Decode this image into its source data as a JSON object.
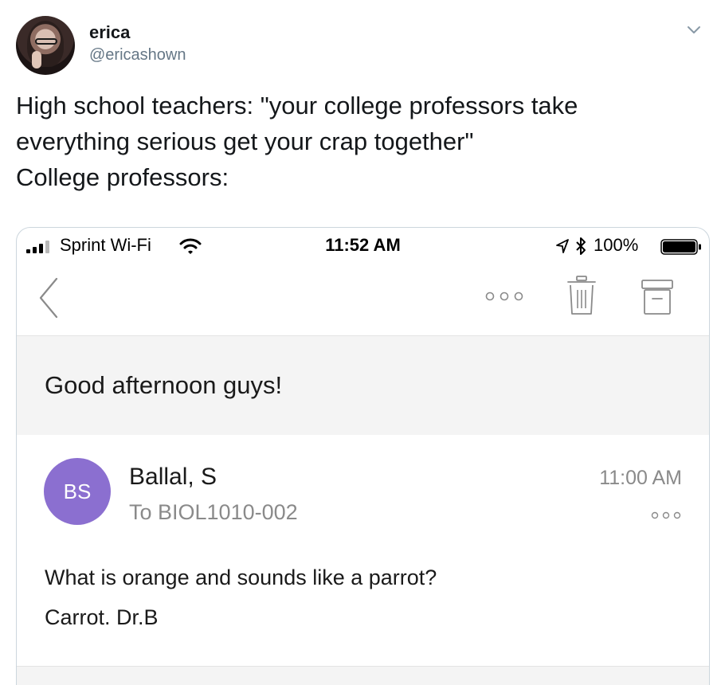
{
  "tweet": {
    "display_name": "erica",
    "handle": "@ericashown",
    "text_lines": [
      "High school teachers: \"your college professors take",
      "everything serious get your crap together\"",
      "College professors:"
    ],
    "icons": {
      "menu": "chevron-down-icon",
      "avatar": "profile-photo"
    }
  },
  "screenshot": {
    "status_bar": {
      "carrier": "Sprint Wi-Fi",
      "time": "11:52 AM",
      "battery_percent": "100%",
      "battery_level": 1.0,
      "icons": [
        "signal-bars-icon",
        "wifi-icon",
        "location-arrow-icon",
        "bluetooth-icon",
        "battery-icon"
      ]
    },
    "nav_bar": {
      "icons": [
        "back-chevron-icon",
        "more-options-icon",
        "trash-icon",
        "archive-icon"
      ]
    },
    "email": {
      "subject": "Good afternoon guys!",
      "sender_initials": "BS",
      "sender_name": "Ballal, S",
      "recipient": "To BIOL1010-002",
      "time": "11:00 AM",
      "body_lines": [
        "What is orange and sounds like a parrot?",
        "Carrot. Dr.B"
      ],
      "avatar_color": "#8b6fd0"
    }
  }
}
